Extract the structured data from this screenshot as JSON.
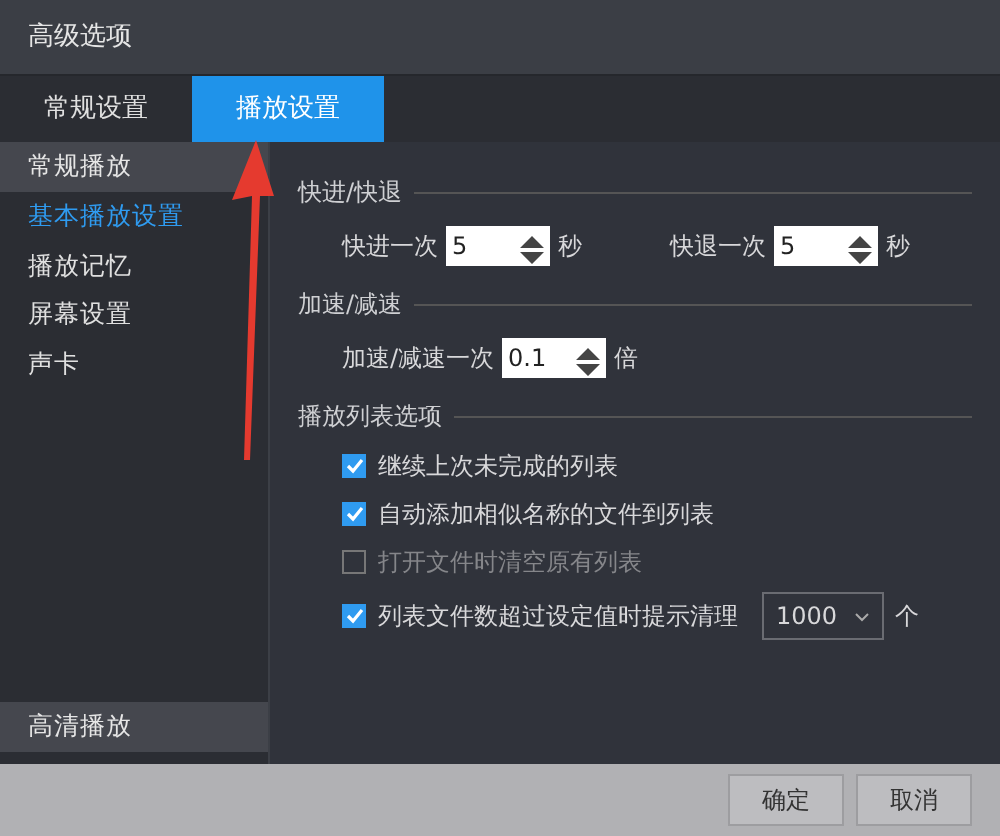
{
  "window": {
    "title": "高级选项"
  },
  "tabs": [
    {
      "label": "常规设置",
      "selected": false
    },
    {
      "label": "播放设置",
      "selected": true
    }
  ],
  "sidebar": {
    "group": "常规播放",
    "items": [
      {
        "label": "基本播放设置",
        "selected": true
      },
      {
        "label": "播放记忆",
        "selected": false
      },
      {
        "label": "屏幕设置",
        "selected": false
      },
      {
        "label": "声卡",
        "selected": false
      }
    ],
    "bottom_group": "高清播放"
  },
  "sections": [
    {
      "title": "快进/快退",
      "rows": [
        {
          "kind": "spinners",
          "items": [
            {
              "label": "快进一次",
              "value": "5",
              "unit": "秒"
            },
            {
              "label": "快退一次",
              "value": "5",
              "unit": "秒"
            }
          ]
        }
      ]
    },
    {
      "title": "加速/减速",
      "rows": [
        {
          "kind": "spinners",
          "items": [
            {
              "label": "加速/减速一次",
              "value": "0.1",
              "unit": "倍"
            }
          ]
        }
      ]
    },
    {
      "title": "播放列表选项",
      "rows": [
        {
          "kind": "checkbox",
          "label": "继续上次未完成的列表",
          "checked": true,
          "disabled": false
        },
        {
          "kind": "checkbox",
          "label": "自动添加相似名称的文件到列表",
          "checked": true,
          "disabled": false
        },
        {
          "kind": "checkbox",
          "label": "打开文件时清空原有列表",
          "checked": false,
          "disabled": true
        },
        {
          "kind": "checkbox",
          "label": "列表文件数超过设定值时提示清理",
          "checked": true,
          "disabled": false,
          "select": "1000",
          "unit": "个"
        }
      ]
    }
  ],
  "buttons": [
    "确定",
    "取消"
  ]
}
